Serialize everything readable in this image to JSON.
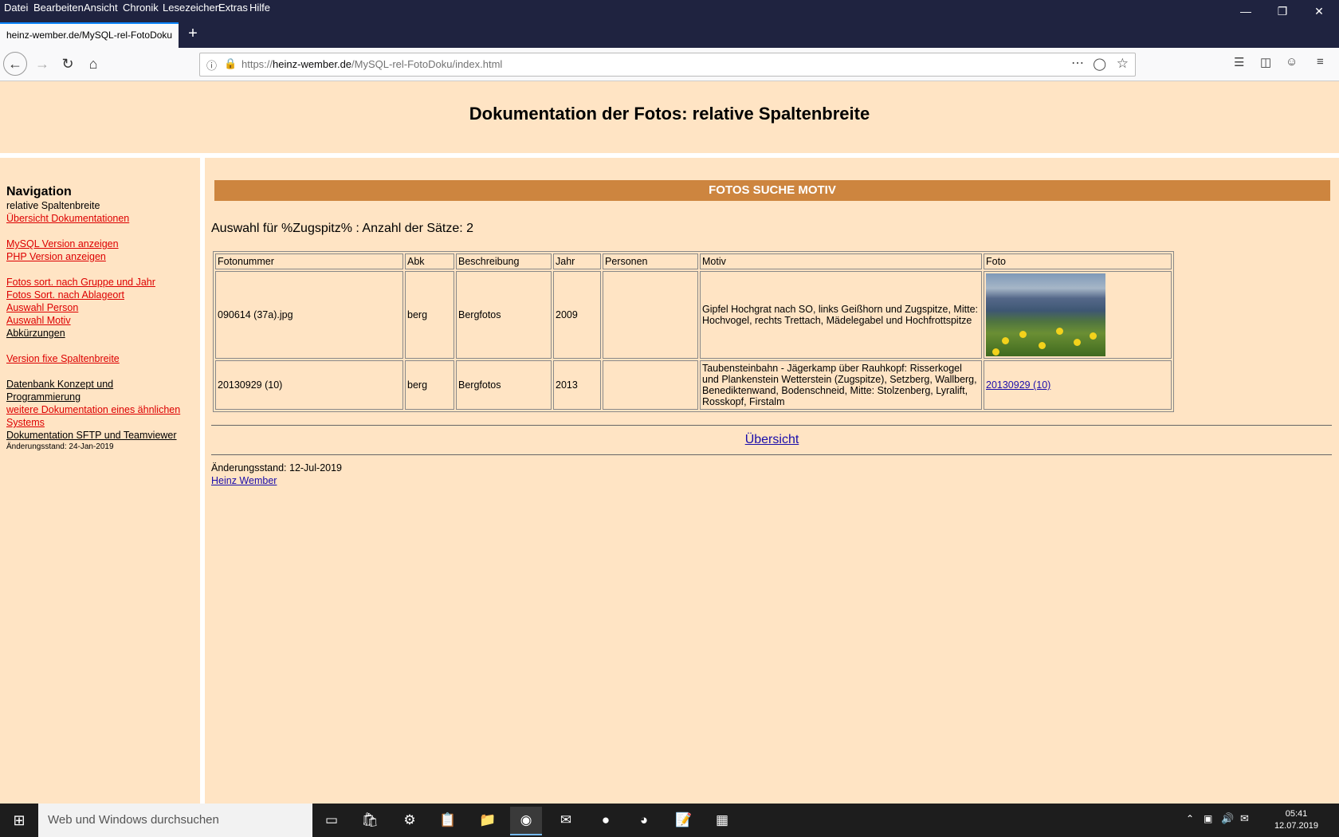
{
  "menubar": {
    "items": [
      "Datei",
      "Bearbeiten",
      "Ansicht",
      "Chronik",
      "Lesezeichen",
      "Extras",
      "Hilfe"
    ],
    "underline_chars": [
      "D",
      "B",
      "A",
      "C",
      "L",
      "E",
      "H"
    ]
  },
  "window_controls": {
    "minimize": "—",
    "restore": "❐",
    "close": "✕"
  },
  "tab": {
    "title": "heinz-wember.de/MySQL-rel-FotoDoku",
    "new_tab": "+"
  },
  "urlbar": {
    "prefix": "https://",
    "domain": "heinz-wember.de",
    "path": "/MySQL-rel-FotoDoku/index.html"
  },
  "page": {
    "title": "Dokumentation der Fotos: relative Spaltenbreite"
  },
  "sidebar": {
    "title": "Navigation",
    "current": "relative Spaltenbreite",
    "links": [
      {
        "label": "Übersicht Dokumentationen",
        "style": "red"
      },
      {
        "label": "MySQL Version anzeigen",
        "style": "red"
      },
      {
        "label": "PHP Version anzeigen",
        "style": "red"
      },
      {
        "label": "Fotos sort. nach Gruppe und Jahr",
        "style": "red"
      },
      {
        "label": "Fotos Sort. nach Ablageort",
        "style": "red"
      },
      {
        "label": "Auswahl Person",
        "style": "red"
      },
      {
        "label": "Auswahl Motiv",
        "style": "red"
      },
      {
        "label": "Abkürzungen",
        "style": "black"
      },
      {
        "label": "Version fixe Spaltenbreite",
        "style": "red"
      },
      {
        "label": "Datenbank Konzept und",
        "style": "black"
      },
      {
        "label": "Programmierung",
        "style": "black"
      },
      {
        "label": "weitere Dokumentation eines ähnlichen",
        "style": "red"
      },
      {
        "label": "Systems",
        "style": "red"
      },
      {
        "label": "Dokumentation SFTP und Teamviewer",
        "style": "black"
      }
    ],
    "updated": "Änderungsstand: 24-Jan-2019"
  },
  "main": {
    "banner": "FOTOS SUCHE MOTIV",
    "selection_text": "Auswahl für %Zugspitz% : Anzahl der Sätze: 2",
    "table": {
      "headers": [
        "Fotonummer",
        "Abk",
        "Beschreibung",
        "Jahr",
        "Personen",
        "Motiv",
        "Foto"
      ],
      "rows": [
        {
          "fotonummer": "090614 (37a).jpg",
          "abk": "berg",
          "beschreibung": "Bergfotos",
          "jahr": "2009",
          "personen": "",
          "motiv": "Gipfel Hochgrat nach SO, links Geißhorn und Zugspitze, Mitte: Hochvogel, rechts Trettach, Mädelegabel und Hochfrottspitze",
          "foto": ""
        },
        {
          "fotonummer": "20130929 (10)",
          "abk": "berg",
          "beschreibung": "Bergfotos",
          "jahr": "2013",
          "personen": "",
          "motiv": "Taubensteinbahn - Jägerkamp über Rauhkopf: Risserkogel und Plankenstein Wetterstein (Zugspitze), Setzberg, Wallberg, Benediktenwand, Bodenschneid, Mitte: Stolzenberg, Lyralift, Rosskopf, Firstalm",
          "foto": "20130929 (10)"
        }
      ]
    },
    "overview_link": "Übersicht",
    "updated": "Änderungsstand: 12-Jul-2019",
    "author": "Heinz Wember"
  },
  "taskbar": {
    "search_placeholder": "Web und Windows durchsuchen",
    "time": "05:41",
    "date": "12.07.2019"
  }
}
